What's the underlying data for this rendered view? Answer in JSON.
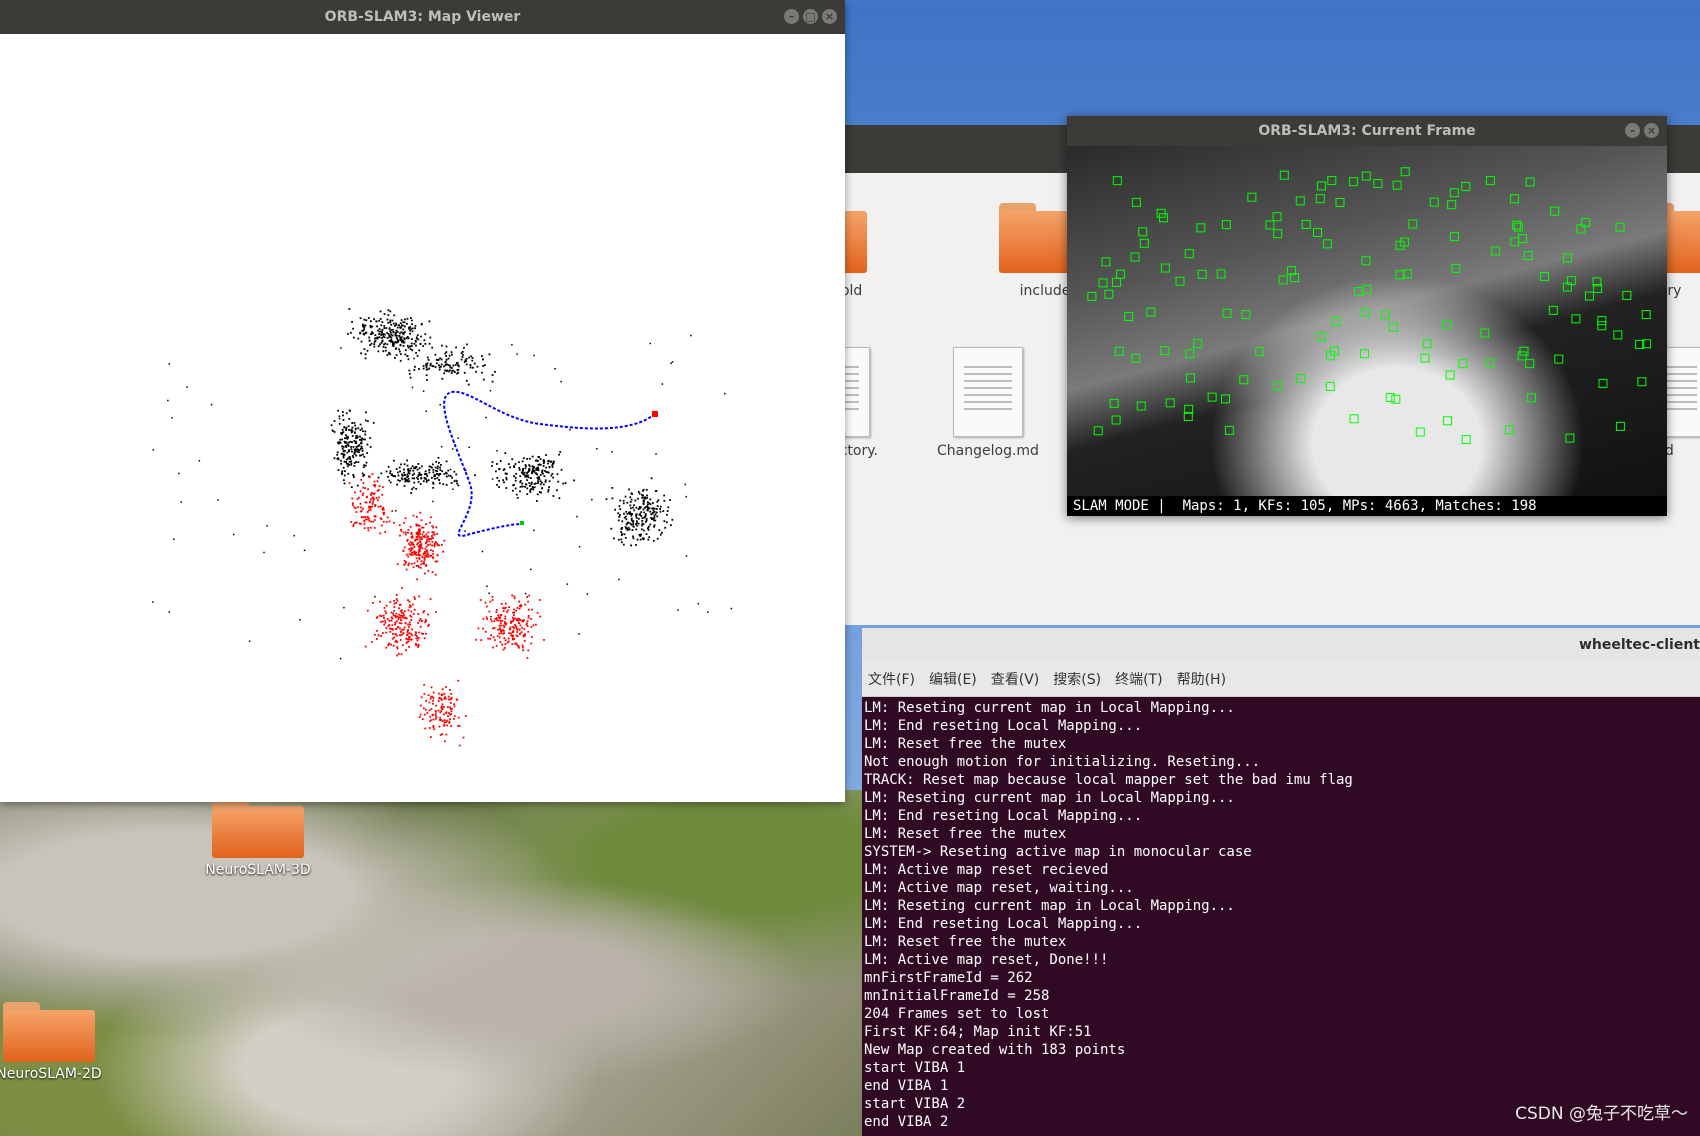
{
  "map_viewer": {
    "title": "ORB-SLAM3: Map Viewer",
    "buttons": [
      "–",
      "□",
      "×"
    ]
  },
  "current_frame": {
    "title": "ORB-SLAM3: Current Frame",
    "buttons": [
      "–",
      "×"
    ],
    "status": "SLAM MODE |  Maps: 1, KFs: 105, MPs: 4663, Matches: 198"
  },
  "file_manager": {
    "items": [
      {
        "label": "mples_old",
        "kind": "folder"
      },
      {
        "label": "include",
        "kind": "folder"
      },
      {
        "label": "ulary",
        "kind": "folder"
      },
      {
        "label": "raTrajectory.\ntxt",
        "kind": "doc"
      },
      {
        "label": "Changelog.md",
        "kind": "doc"
      },
      {
        "label": "E.md",
        "kind": "doc"
      }
    ]
  },
  "desktop": {
    "icons": [
      "NeuroSLAM-3D",
      "NeuroSLAM-2D"
    ]
  },
  "terminal": {
    "title": "wheeltec-client",
    "menu": [
      "文件(F)",
      "编辑(E)",
      "查看(V)",
      "搜索(S)",
      "终端(T)",
      "帮助(H)"
    ],
    "lines": [
      "LM: Reseting current map in Local Mapping...",
      "LM: End reseting Local Mapping...",
      "LM: Reset free the mutex",
      "Not enough motion for initializing. Reseting...",
      "TRACK: Reset map because local mapper set the bad imu flag",
      "LM: Reseting current map in Local Mapping...",
      "LM: End reseting Local Mapping...",
      "LM: Reset free the mutex",
      "SYSTEM-> Reseting active map in monocular case",
      "LM: Active map reset recieved",
      "LM: Active map reset, waiting...",
      "LM: Reseting current map in Local Mapping...",
      "LM: End reseting Local Mapping...",
      "LM: Reset free the mutex",
      "LM: Active map reset, Done!!!",
      "mnFirstFrameId = 262",
      "mnInitialFrameId = 258",
      "204 Frames set to lost",
      "First KF:64; Map init KF:51",
      "New Map created with 183 points",
      "start VIBA 1",
      "end VIBA 1",
      "start VIBA 2",
      "end VIBA 2"
    ]
  },
  "watermark": "CSDN @兔子不吃草～",
  "colors": {
    "map_points": "#000000",
    "local_points": "#ff0000",
    "trajectory": "#0000ff",
    "features": "#00ff00",
    "terminal_bg": "#300a24"
  }
}
